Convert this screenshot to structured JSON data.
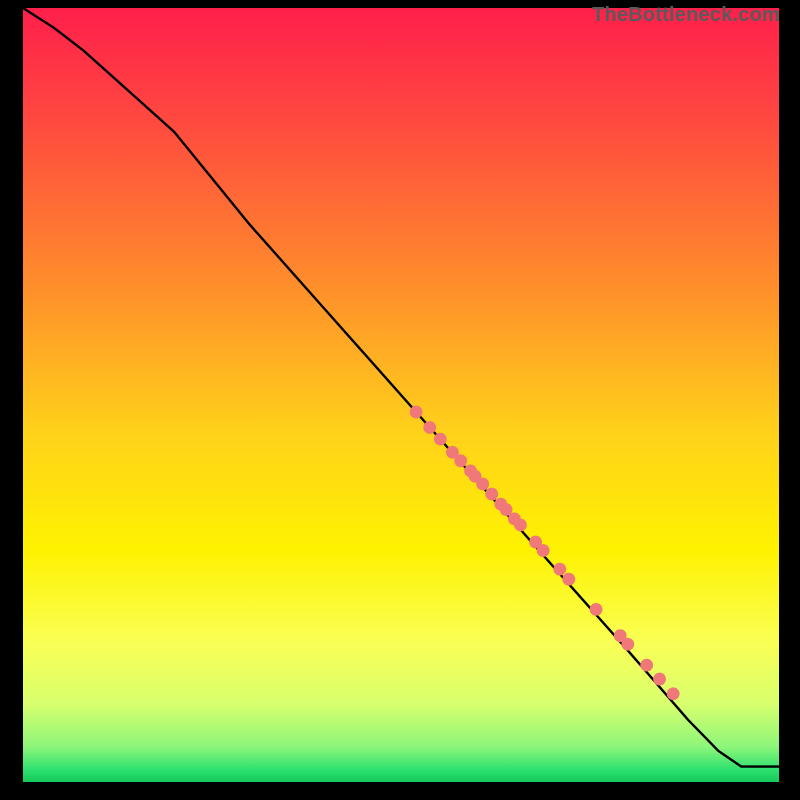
{
  "watermark": "TheBottleneck.com",
  "chart_data": {
    "type": "line",
    "title": "",
    "xlabel": "",
    "ylabel": "",
    "xlim": [
      0,
      100
    ],
    "ylim": [
      0,
      100
    ],
    "grid": false,
    "legend": false,
    "gradient_stops": [
      {
        "pos": 0.0,
        "color": "#ff1f4b"
      },
      {
        "pos": 0.15,
        "color": "#ff4a3f"
      },
      {
        "pos": 0.35,
        "color": "#ff8b2c"
      },
      {
        "pos": 0.55,
        "color": "#ffd21a"
      },
      {
        "pos": 0.7,
        "color": "#fef200"
      },
      {
        "pos": 0.82,
        "color": "#faff55"
      },
      {
        "pos": 0.9,
        "color": "#d7ff6e"
      },
      {
        "pos": 0.955,
        "color": "#8cf57a"
      },
      {
        "pos": 0.985,
        "color": "#2be06e"
      },
      {
        "pos": 1.0,
        "color": "#16c95b"
      }
    ],
    "series": [
      {
        "name": "curve",
        "type": "line",
        "color": "#000000",
        "x": [
          0,
          4,
          8,
          12,
          16,
          20,
          30,
          40,
          50,
          60,
          70,
          80,
          88,
          92,
          95,
          100
        ],
        "y": [
          100,
          97.5,
          94.5,
          91,
          87.5,
          84,
          72,
          61,
          50,
          39,
          28,
          17,
          8,
          4,
          2,
          2
        ]
      },
      {
        "name": "dots",
        "type": "scatter",
        "color": "#f07878",
        "radius": 6.4,
        "x": [
          52.0,
          53.8,
          55.2,
          56.8,
          57.9,
          59.2,
          59.8,
          60.8,
          62.0,
          63.2,
          63.9,
          65.0,
          65.8,
          67.8,
          68.8,
          71.0,
          72.2,
          75.8,
          79.0,
          80.0,
          82.5,
          84.2,
          86.0
        ],
        "y": [
          47.8,
          45.8,
          44.3,
          42.6,
          41.5,
          40.2,
          39.5,
          38.5,
          37.2,
          35.9,
          35.2,
          34.0,
          33.2,
          31.0,
          29.9,
          27.5,
          26.2,
          22.3,
          18.9,
          17.8,
          15.1,
          13.3,
          11.4
        ]
      }
    ]
  }
}
